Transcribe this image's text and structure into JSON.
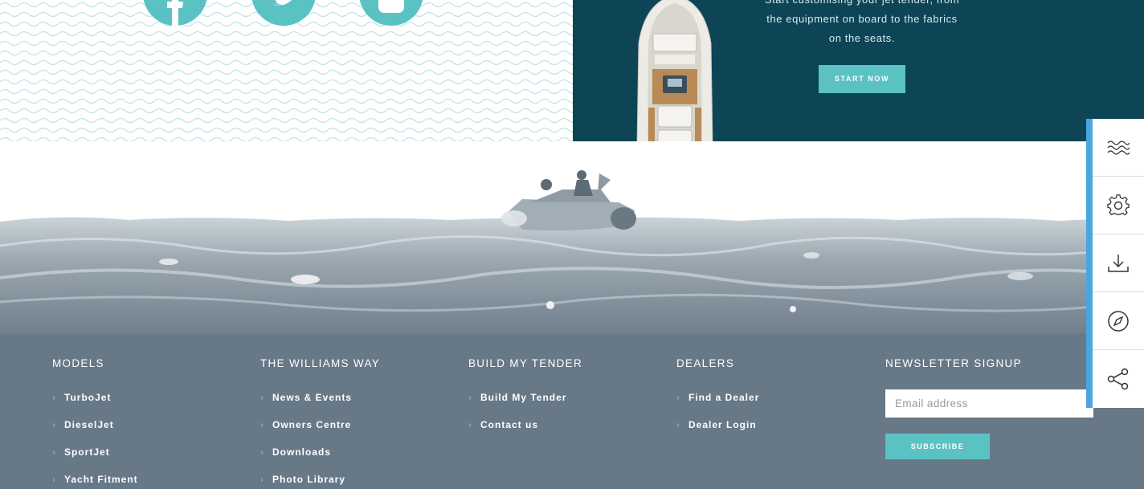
{
  "social": {
    "icons": [
      "facebook-icon",
      "twitter-icon",
      "youtube-icon"
    ],
    "color": "#5bc2c4"
  },
  "customise": {
    "text_line1": "Start customising your jet tender, from",
    "text_line2": "the equipment on board to the fabrics",
    "text_line3": "on the seats.",
    "button_label": "START NOW",
    "background": "#0d4556"
  },
  "footer": {
    "columns": [
      {
        "heading": "MODELS",
        "links": [
          "TurboJet",
          "DieselJet",
          "SportJet",
          "Yacht Fitment"
        ]
      },
      {
        "heading": "THE WILLIAMS WAY",
        "links": [
          "News & Events",
          "Owners Centre",
          "Downloads",
          "Photo Library"
        ]
      },
      {
        "heading": "BUILD MY TENDER",
        "links": [
          "Build My Tender",
          "Contact us"
        ]
      },
      {
        "heading": "DEALERS",
        "links": [
          "Find a Dealer",
          "Dealer Login"
        ]
      }
    ],
    "newsletter": {
      "heading": "NEWSLETTER SIGNUP",
      "placeholder": "Email address",
      "button_label": "SUBSCRIBE"
    },
    "background": "#677887"
  },
  "toolbar": {
    "items": [
      "waves-icon",
      "gear-icon",
      "download-icon",
      "compass-icon",
      "share-icon"
    ],
    "accent": "#4aa6dc"
  }
}
